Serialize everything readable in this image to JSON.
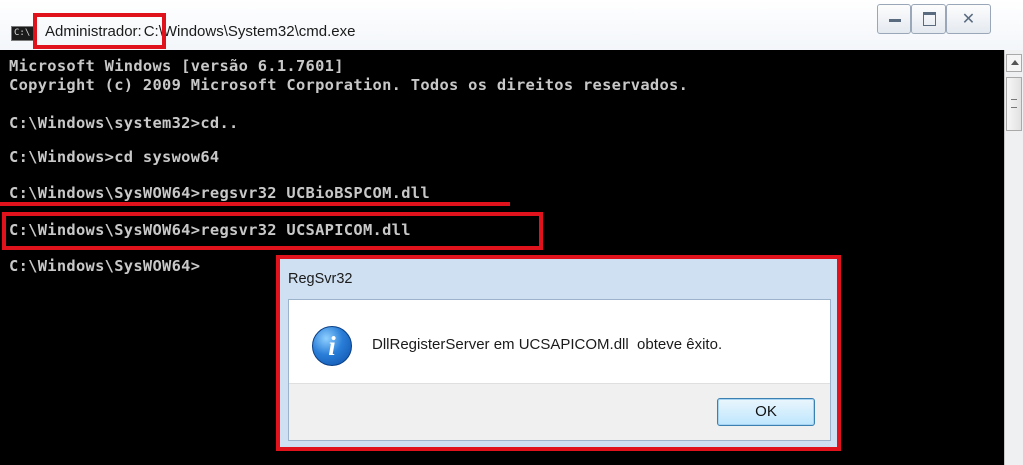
{
  "window": {
    "title_prefix": "Administrador:",
    "title_path": "C:\\Windows\\System32\\cmd.exe",
    "icon_text": "C:\\",
    "close_glyph": "✕"
  },
  "console": {
    "lines": [
      "Microsoft Windows [versão 6.1.7601]",
      "Copyright (c) 2009 Microsoft Corporation. Todos os direitos reservados.",
      "C:\\Windows\\system32>cd..",
      "C:\\Windows>cd syswow64",
      "C:\\Windows\\SysWOW64>regsvr32 UCBioBSPCOM.dll",
      "C:\\Windows\\SysWOW64>regsvr32 UCSAPICOM.dll",
      "C:\\Windows\\SysWOW64>"
    ]
  },
  "dialog": {
    "title": "RegSvr32",
    "message": "DllRegisterServer em UCSAPICOM.dll  obteve êxito.",
    "ok_label": "OK",
    "icon": "information-icon"
  },
  "annotations": {
    "highlight_color": "#e0121b"
  }
}
